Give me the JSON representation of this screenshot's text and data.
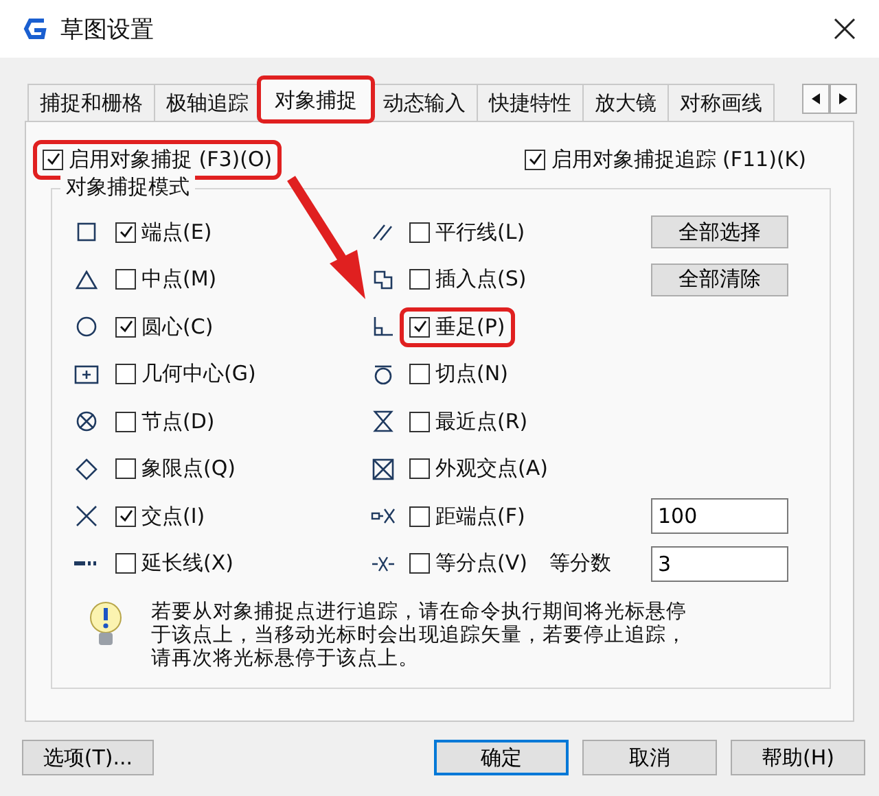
{
  "window": {
    "title": "草图设置"
  },
  "tabs": [
    {
      "label": "捕捉和栅格",
      "selected": false,
      "highlighted": false
    },
    {
      "label": "极轴追踪",
      "selected": false,
      "highlighted": false
    },
    {
      "label": "对象捕捉",
      "selected": true,
      "highlighted": true
    },
    {
      "label": "动态输入",
      "selected": false,
      "highlighted": false
    },
    {
      "label": "快捷特性",
      "selected": false,
      "highlighted": false
    },
    {
      "label": "放大镜",
      "selected": false,
      "highlighted": false
    },
    {
      "label": "对称画线",
      "selected": false,
      "highlighted": false
    }
  ],
  "enable_snap": {
    "label": "启用对象捕捉 (F3)(O)",
    "checked": true,
    "highlighted": true
  },
  "enable_tracking": {
    "label": "启用对象捕捉追踪 (F11)(K)",
    "checked": true
  },
  "snap_modes": {
    "title": "对象捕捉模式",
    "left": [
      {
        "label": "端点(E)",
        "checked": true
      },
      {
        "label": "中点(M)",
        "checked": false
      },
      {
        "label": "圆心(C)",
        "checked": true
      },
      {
        "label": "几何中心(G)",
        "checked": false
      },
      {
        "label": "节点(D)",
        "checked": false
      },
      {
        "label": "象限点(Q)",
        "checked": false
      },
      {
        "label": "交点(I)",
        "checked": true
      },
      {
        "label": "延长线(X)",
        "checked": false
      }
    ],
    "right": [
      {
        "label": "平行线(L)",
        "checked": false,
        "highlighted": false
      },
      {
        "label": "插入点(S)",
        "checked": false,
        "highlighted": false
      },
      {
        "label": "垂足(P)",
        "checked": true,
        "highlighted": true
      },
      {
        "label": "切点(N)",
        "checked": false,
        "highlighted": false
      },
      {
        "label": "最近点(R)",
        "checked": false,
        "highlighted": false
      },
      {
        "label": "外观交点(A)",
        "checked": false,
        "highlighted": false
      },
      {
        "label": "距端点(F)",
        "checked": false,
        "highlighted": false
      },
      {
        "label": "等分点(V)",
        "checked": false,
        "highlighted": false
      }
    ],
    "buttons": [
      "全部选择",
      "全部清除"
    ],
    "from_distance": {
      "value": "100"
    },
    "divide": {
      "label": "等分数",
      "value": "3"
    },
    "hint": "若要从对象捕捉点进行追踪，请在命令执行期间将光标悬停于该点上，当移动光标时会出现追踪矢量，若要停止追踪，请再次将光标悬停于该点上。"
  },
  "footer": {
    "options": "选项(T)...",
    "ok": "确定",
    "cancel": "取消",
    "help": "帮助(H)"
  }
}
